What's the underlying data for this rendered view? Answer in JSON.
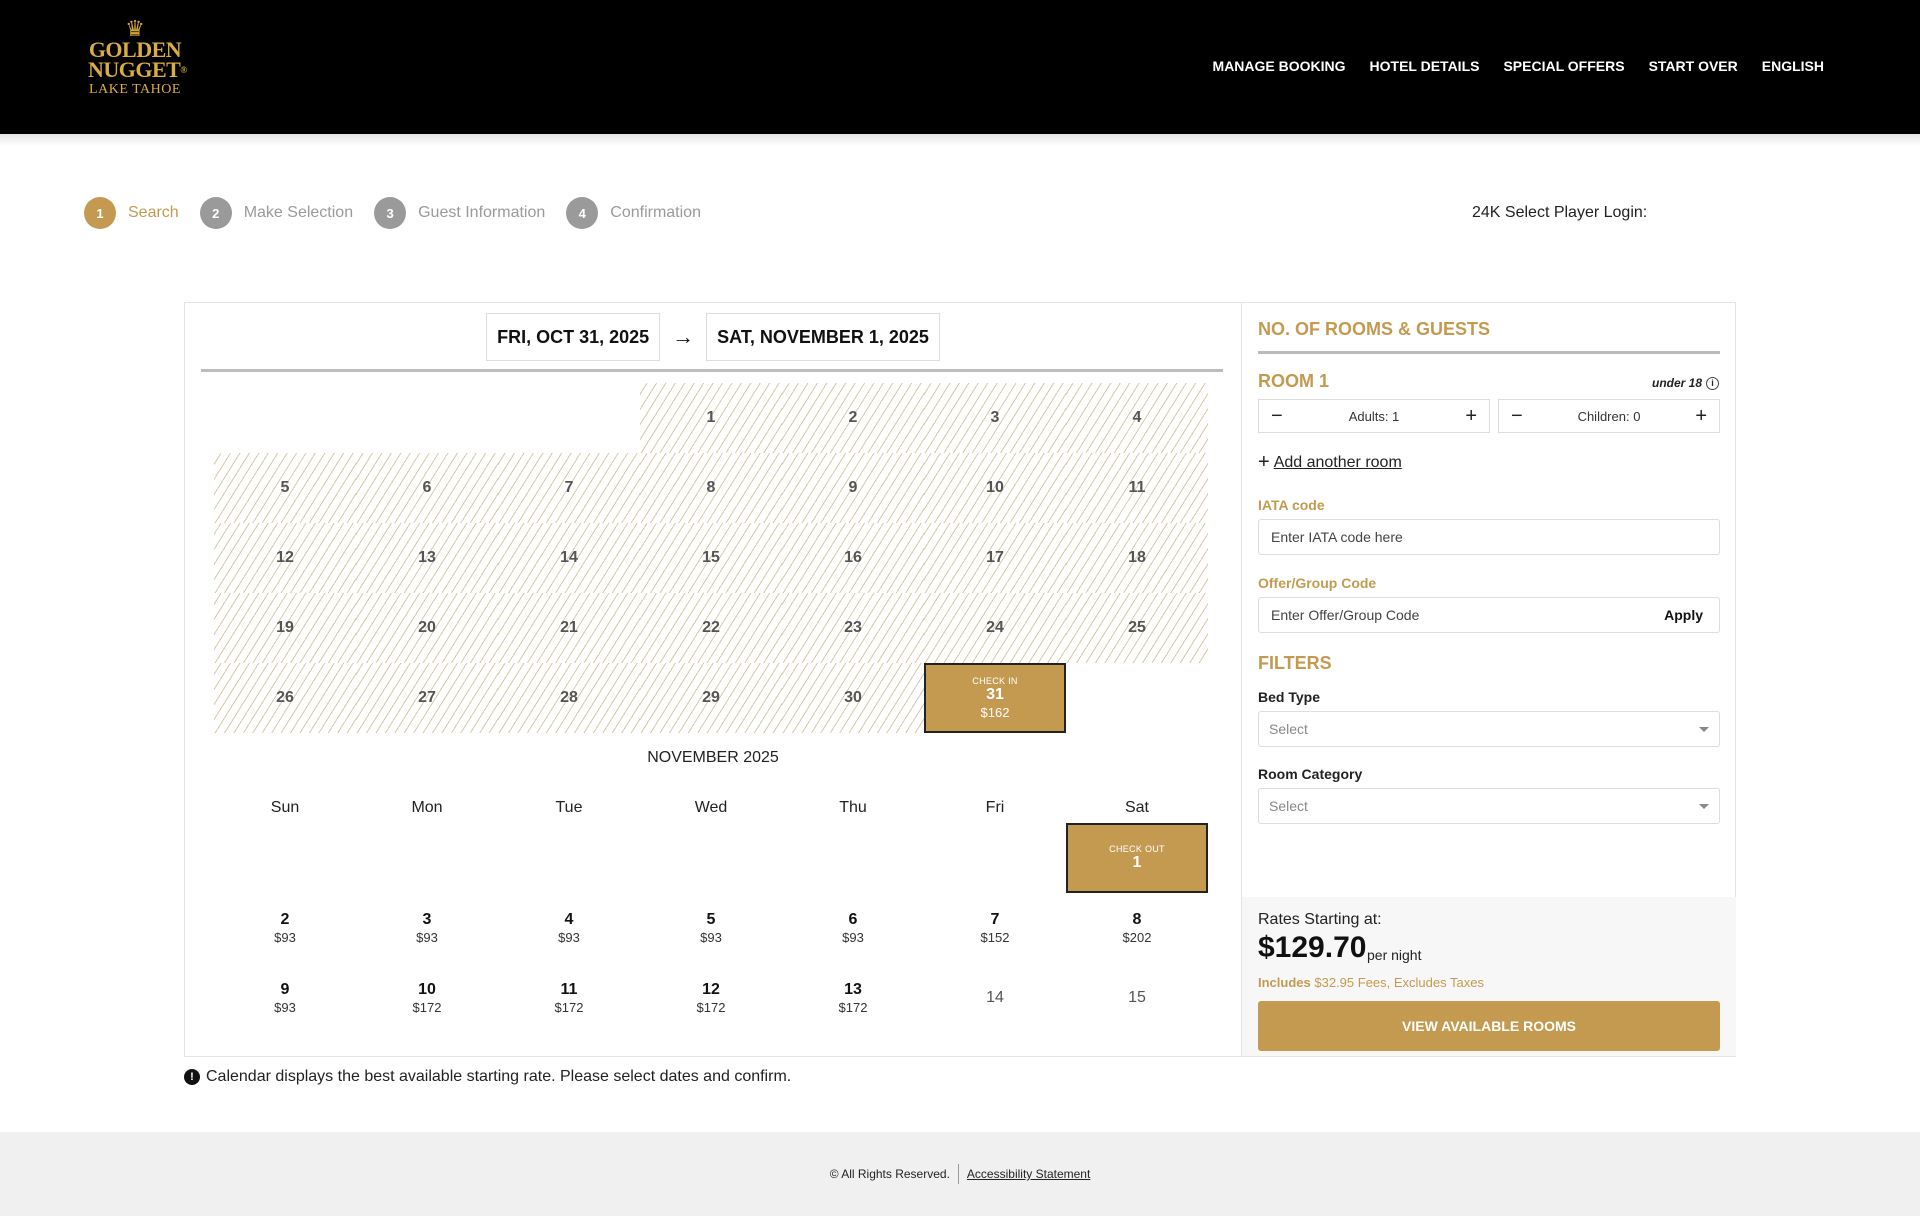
{
  "brand": {
    "line1": "GOLDEN",
    "line2": "NUGGET",
    "line3": "LAKE TAHOE",
    "crown": "♛",
    "registered": "®"
  },
  "nav": [
    "MANAGE BOOKING",
    "HOTEL DETAILS",
    "SPECIAL OFFERS",
    "START OVER",
    "ENGLISH"
  ],
  "steps": [
    {
      "num": "1",
      "label": "Search"
    },
    {
      "num": "2",
      "label": "Make Selection"
    },
    {
      "num": "3",
      "label": "Guest Information"
    },
    {
      "num": "4",
      "label": "Confirmation"
    }
  ],
  "player_login": "24K Select Player Login:",
  "dates": {
    "check_in": "FRI, OCT 31, 2025",
    "arrow": "→",
    "check_out": "SAT, NOVEMBER 1, 2025"
  },
  "october": {
    "rows": [
      [
        "",
        "",
        "",
        "1",
        "2",
        "3",
        "4"
      ],
      [
        "5",
        "6",
        "7",
        "8",
        "9",
        "10",
        "11"
      ],
      [
        "12",
        "13",
        "14",
        "15",
        "16",
        "17",
        "18"
      ],
      [
        "19",
        "20",
        "21",
        "22",
        "23",
        "24",
        "25"
      ],
      [
        "26",
        "27",
        "28",
        "29",
        "30",
        "31",
        ""
      ]
    ],
    "check_in_tag": "CHECK IN",
    "check_in_price": "$162"
  },
  "november": {
    "title": "NOVEMBER 2025",
    "weekdays": [
      "Sun",
      "Mon",
      "Tue",
      "Wed",
      "Thu",
      "Fri",
      "Sat"
    ],
    "check_out_tag": "CHECK OUT",
    "check_out_day": "1",
    "rows": [
      [
        [
          "2",
          "$93"
        ],
        [
          "3",
          "$93"
        ],
        [
          "4",
          "$93"
        ],
        [
          "5",
          "$93"
        ],
        [
          "6",
          "$93"
        ],
        [
          "7",
          "$152"
        ],
        [
          "8",
          "$202"
        ]
      ],
      [
        [
          "9",
          "$93"
        ],
        [
          "10",
          "$172"
        ],
        [
          "11",
          "$172"
        ],
        [
          "12",
          "$172"
        ],
        [
          "13",
          "$172"
        ],
        [
          "14",
          ""
        ],
        [
          "15",
          ""
        ]
      ]
    ]
  },
  "guests": {
    "title": "NO. OF ROOMS & GUESTS",
    "room_label": "ROOM 1",
    "under18": "under 18",
    "info_icon": "i",
    "adults": "Adults: 1",
    "children": "Children: 0",
    "minus": "−",
    "plus": "+",
    "add_room": "Add another room",
    "iata_label": "IATA code",
    "iata_placeholder": "Enter IATA code here",
    "offer_label": "Offer/Group Code",
    "offer_placeholder": "Enter Offer/Group Code",
    "apply": "Apply"
  },
  "filters": {
    "title": "FILTERS",
    "bed_type_label": "Bed Type",
    "bed_type_value": "Select",
    "room_category_label": "Room Category",
    "room_category_value": "Select"
  },
  "rates": {
    "starting": "Rates Starting at:",
    "amount": "$129.70",
    "per_night": "per night",
    "includes_word": "Includes",
    "includes_rest": "$32.95 Fees, Excludes Taxes",
    "button": "VIEW AVAILABLE ROOMS"
  },
  "note": {
    "icon": "!",
    "text": "Calendar displays the best available starting rate. Please select dates and confirm."
  },
  "footer": {
    "rights": "© All Rights Reserved.",
    "accessibility": "Accessibility Statement"
  },
  "colors": {
    "accent": "#c49a50",
    "header_bg": "#000000",
    "grey_step": "#9a9a9a"
  }
}
